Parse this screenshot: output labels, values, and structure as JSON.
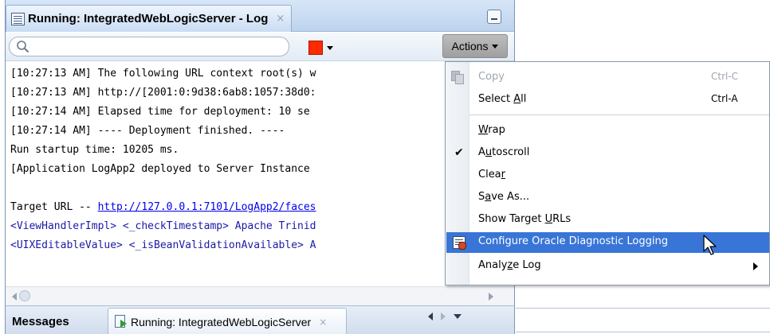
{
  "log_panel": {
    "title": "Running: IntegratedWebLogicServer - Log",
    "title_close": "×",
    "search_placeholder": "",
    "actions_label": "Actions",
    "log_lines": [
      {
        "text": "[10:27:13 AM] The following URL context root(s) w",
        "style": "plain"
      },
      {
        "text": "[10:27:13 AM] http://[2001:0:9d38:6ab8:1057:38d0:",
        "style": "plain"
      },
      {
        "text": "[10:27:14 AM] Elapsed time for deployment:  10 se",
        "style": "plain"
      },
      {
        "text": "[10:27:14 AM] ----  Deployment finished.  ----",
        "style": "plain"
      },
      {
        "text": "Run startup time: 10205 ms.",
        "style": "plain"
      },
      {
        "text": "[Application LogApp2 deployed to Server Instance",
        "style": "plain"
      },
      {
        "text": "",
        "style": "plain"
      },
      {
        "text": "Target URL -- ",
        "link": "http://127.0.0.1:7101/LogApp2/faces",
        "style": "plain"
      },
      {
        "text": "<ViewHandlerImpl> <_checkTimestamp> Apache Trinid",
        "style": "blue"
      },
      {
        "text": "<UIXEditableValue> <_isBeanValidationAvailable> A",
        "style": "blue"
      }
    ]
  },
  "bottom_tabs": {
    "messages_label": "Messages",
    "running_label": "Running: IntegratedWebLogicServer",
    "running_close": "×"
  },
  "actions_menu": {
    "items": [
      {
        "label": "Copy",
        "shortcut": "Ctrl-C",
        "disabled": true,
        "icon": "copy-icon"
      },
      {
        "label_parts": [
          "Select ",
          "A",
          "ll"
        ],
        "label": "Select All",
        "shortcut": "Ctrl-A"
      },
      {
        "label_parts": [
          "",
          "W",
          "rap"
        ],
        "label": "Wrap"
      },
      {
        "label_parts": [
          "A",
          "u",
          "toscroll"
        ],
        "label": "Autoscroll",
        "checked": true,
        "icon": "check-icon"
      },
      {
        "label_parts": [
          "Clea",
          "r",
          ""
        ],
        "label": "Clear"
      },
      {
        "label_parts": [
          "S",
          "a",
          "ve As..."
        ],
        "label": "Save As..."
      },
      {
        "label_parts": [
          "Show Target ",
          "U",
          "RLs"
        ],
        "label": "Show Target URLs"
      },
      {
        "label": "Configure Oracle Diagnostic Logging",
        "selected": true,
        "icon": "config-icon"
      },
      {
        "label_parts": [
          "Analy",
          "z",
          "e Log"
        ],
        "label": "Analyze Log",
        "submenu": true
      }
    ],
    "check_mark": "✔"
  },
  "colors": {
    "selection": "#3875d7",
    "filter_swatch": "#ff2a00",
    "log_blue": "#1a1aa6",
    "link": "#0000ee"
  }
}
